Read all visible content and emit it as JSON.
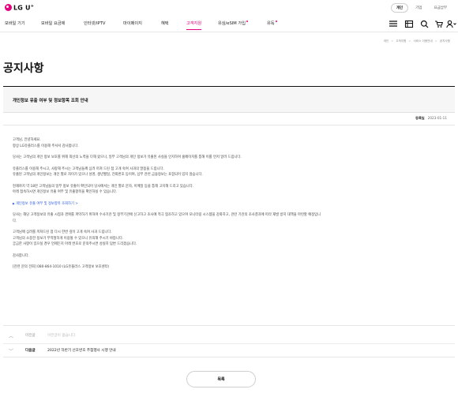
{
  "brand": {
    "logo_text": "LG U",
    "logo_sup": "+"
  },
  "audience_tabs": [
    {
      "label": "개인",
      "active": true
    },
    {
      "label": "기업",
      "active": false
    },
    {
      "label": "요금납부",
      "active": false
    }
  ],
  "gnb": [
    {
      "label": "모바일 기기",
      "active": false,
      "dot": false
    },
    {
      "label": "모바일 요금제",
      "active": false,
      "dot": false
    },
    {
      "label": "인터넷/IPTV",
      "active": false,
      "dot": false
    },
    {
      "label": "마이페이지",
      "active": false,
      "dot": false
    },
    {
      "label": "혜택",
      "active": false,
      "dot": false
    },
    {
      "label": "고객지원",
      "active": true,
      "dot": false
    },
    {
      "label": "유심/eSIM 가입",
      "active": false,
      "dot": true
    },
    {
      "label": "유독",
      "active": false,
      "dot": true
    }
  ],
  "breadcrumb": [
    "개인",
    "고객지원",
    "서비스 이용안내",
    "공지사항"
  ],
  "page_title": "공지사항",
  "notice": {
    "title": "개인정보 유출 여부 및 정보항목 조회 안내",
    "date_label": "등록일",
    "date": "2023-01-11",
    "paragraphs": [
      [
        "고객님, 안녕하세요.",
        "항상 LG유플러스를 이용해 주셔서 감사합니다."
      ],
      [
        "당사는 고객님의 개인 정보 보호를 위해 최선의 노력을 다해 왔으나, 일부 고객님의 개인 정보가 유출된 사실을 인지하여 홈페이지를 통해 이를 먼저 알려 드립니다."
      ],
      [
        "유플러스를 이용해 주시고, 사랑해 주시는 고객님들께 심려 끼쳐 드린 점 고개 숙여 사과의 말씀을 드립니다.",
        "유출된 고객님의 개인정보는 개인 별로 차이가 있으나 성명, 생년월일, 전화번호 등이며, 납부 관련 금융정보는 포함되어 있지 않습니다."
      ],
      [
        "현재까지 약 18만 고객님들의 일부 정보 유출이 확인되어 당사에서는 개인 별로 문자, 이메일 등을 통해 고지해 드리고 있습니다.",
        "아래 접속하시면 개인정보 유출 여부 및 유출항목을 확인하실 수 있습니다."
      ]
    ],
    "link_text": "개인정보 유출 여부 및 정보항목 조회하기 >",
    "paragraphs2": [
      [
        "당사는 해당 고객정보의 유출 시점과 경위를 파악하기 위하여 수사기관 및 정부기관에 신고하고 조사에 적극 협조하고 있으며 모니터링 시스템을 강화하고, 관련 기관의 조사결과에 따라 재발 방지 대책을 마련할 예정입니",
        "다."
      ],
      [
        "고객님께 심려를 끼쳐드린 점 다시 한번 깊이 고개 숙여 사과 드립니다.",
        "고객님의 소중한 정보가 부적절하게 이용될 수 있으니 유의해 주시기 바랍니다.",
        "궁금한 사항이 있으실 경우 언제든지 아래 번호로 문의주시면 성실히 답변 드리겠습니다."
      ],
      [
        "감사합니다."
      ],
      [
        "[관련 문의 전화] 080-864-1010 (LG유플러스 고객정보 보호센터)"
      ]
    ]
  },
  "prev": {
    "label": "이전글",
    "text": "이전글이 없습니다."
  },
  "next": {
    "label": "다음글",
    "text": "2022년 하반기 선호번호 추첨행사 시행 안내"
  },
  "list_button": "목록"
}
